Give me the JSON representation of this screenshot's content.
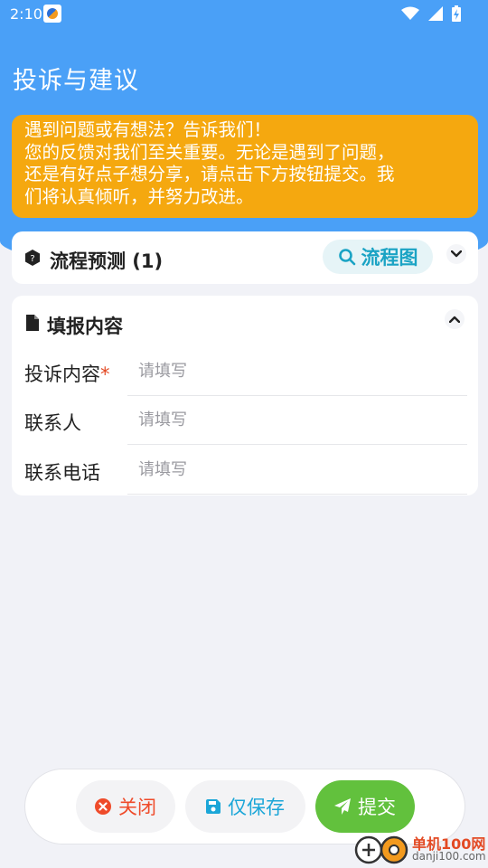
{
  "status_bar": {
    "time": "2:10"
  },
  "page": {
    "title": "投诉与建议"
  },
  "notice": {
    "lines": [
      "遇到问题或有想法？告诉我们！",
      "您的反馈对我们至关重要。无论是遇到了问题，",
      "还是有好点子想分享，请点击下方按钮提交。我",
      "们将认真倾听，并努力改进。"
    ]
  },
  "flow_card": {
    "title": "流程预测 (1)",
    "flow_chart_button": "流程图"
  },
  "form_card": {
    "title": "填报内容",
    "fields": [
      {
        "label": "投诉内容",
        "required_mark": "*",
        "placeholder": "请填写",
        "value": ""
      },
      {
        "label": "联系人",
        "placeholder": "请填写",
        "value": ""
      },
      {
        "label": "联系电话",
        "placeholder": "请填写",
        "value": ""
      }
    ]
  },
  "actions": {
    "close_label": "关闭",
    "save_label": "仅保存",
    "submit_label": "提交"
  },
  "watermark": {
    "name": "单机100网",
    "url": "danji100.com"
  },
  "colors": {
    "header_blue": "#4aa0f7",
    "notice_orange": "#f5a80f",
    "accent_teal": "#1aa3c4",
    "danger": "#ef4b2a",
    "submit_green": "#62c13d"
  }
}
